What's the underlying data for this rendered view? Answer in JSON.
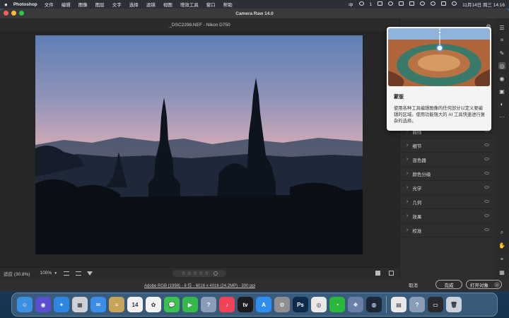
{
  "menubar": {
    "app": "Photoshop",
    "items": [
      "文件",
      "编辑",
      "图像",
      "图层",
      "文字",
      "选择",
      "滤镜",
      "视图",
      "增效工具",
      "窗口",
      "帮助"
    ],
    "input_method": "中",
    "wechat_badge": "1",
    "datetime": "11月14日 周三 14:16"
  },
  "window": {
    "title": "Camera Raw 14.0",
    "file_info": "_DSC2298.NEF  -  Nikon D750"
  },
  "canvas": {
    "zoom_label": "适应 (30.8%)",
    "zoom_percent": "100%",
    "stars": [
      "☆",
      "☆",
      "☆",
      "☆",
      "☆"
    ]
  },
  "footer": {
    "workflow": "Adobe RGB (1998) - 8 位 - 6016 x 4016 (24.2MP) - 300 ppi",
    "cancel": "取消",
    "done": "完成",
    "open": "打开对象",
    "open_chevron": "⌄"
  },
  "popup": {
    "title": "蒙版",
    "description": "使用各种工具编辑图像的任何部分以定义要编辑的区域。使用功能强大的 AI 工具快速进行复杂的选择。"
  },
  "panel": {
    "sections": [
      "曲线",
      "细节",
      "混色器",
      "颜色分级",
      "光学",
      "几何",
      "效果",
      "校准"
    ]
  },
  "tools": [
    {
      "name": "edit-icon",
      "glyph": "☰"
    },
    {
      "name": "crop-icon",
      "glyph": "⌗"
    },
    {
      "name": "healing-icon",
      "glyph": "✎"
    },
    {
      "name": "masking-icon",
      "glyph": "◎"
    },
    {
      "name": "redeye-icon",
      "glyph": "◉"
    },
    {
      "name": "snapshots-icon",
      "glyph": "▣"
    },
    {
      "name": "presets-icon",
      "glyph": "◐"
    },
    {
      "name": "more-icon",
      "glyph": "···"
    },
    {
      "name": "zoom-icon",
      "glyph": "⌕"
    },
    {
      "name": "hand-icon",
      "glyph": "✋"
    },
    {
      "name": "sampler-icon",
      "glyph": "⌖"
    },
    {
      "name": "grid-icon",
      "glyph": "▦"
    },
    {
      "name": "settings-icon",
      "glyph": "⚙"
    }
  ],
  "dock": [
    {
      "name": "finder-icon",
      "glyph": "☺",
      "color": "#3d8fe0"
    },
    {
      "name": "siri-icon",
      "glyph": "◉",
      "color": "#5a4fcf"
    },
    {
      "name": "safari-icon",
      "glyph": "✦",
      "color": "#2f86e0"
    },
    {
      "name": "launchpad-icon",
      "glyph": "▦",
      "color": "#cfcfd6"
    },
    {
      "name": "mail-icon",
      "glyph": "✉",
      "color": "#3b8de8"
    },
    {
      "name": "notes-icon",
      "glyph": "≡",
      "color": "#c8a45a"
    },
    {
      "name": "calendar-icon",
      "glyph": "14",
      "color": "#f2f2f2"
    },
    {
      "name": "photos-icon",
      "glyph": "✿",
      "color": "#f4f4f4"
    },
    {
      "name": "messages-icon",
      "glyph": "💬",
      "color": "#39c24f"
    },
    {
      "name": "facetime-icon",
      "glyph": "▶",
      "color": "#36b94a"
    },
    {
      "name": "help-icon",
      "glyph": "?",
      "color": "#8a9cb8"
    },
    {
      "name": "music-icon",
      "glyph": "♪",
      "color": "#f0435a"
    },
    {
      "name": "appletv-icon",
      "glyph": "tv",
      "color": "#1c1c1e"
    },
    {
      "name": "appstore-icon",
      "glyph": "A",
      "color": "#2f8ef0"
    },
    {
      "name": "system-settings-icon",
      "glyph": "⚙",
      "color": "#8e8e93"
    },
    {
      "name": "photoshop-icon",
      "glyph": "Ps",
      "color": "#0d2a4a"
    },
    {
      "name": "chrome-icon",
      "glyph": "◎",
      "color": "#e9e9e9"
    },
    {
      "name": "wechat-icon",
      "glyph": "◔",
      "color": "#29b83b"
    },
    {
      "name": "network-icon",
      "glyph": "❖",
      "color": "#6a7ea8"
    },
    {
      "name": "steam-icon",
      "glyph": "◍",
      "color": "#1b2838"
    },
    {
      "name": "document-icon",
      "glyph": "▤",
      "color": "#e8e8e8"
    },
    {
      "name": "help2-icon",
      "glyph": "?",
      "color": "#8a9cb8"
    },
    {
      "name": "screen-icon",
      "glyph": "▭",
      "color": "#2a2a2e"
    },
    {
      "name": "trash-icon",
      "glyph": "🗑",
      "color": "#c9d2dc"
    }
  ]
}
